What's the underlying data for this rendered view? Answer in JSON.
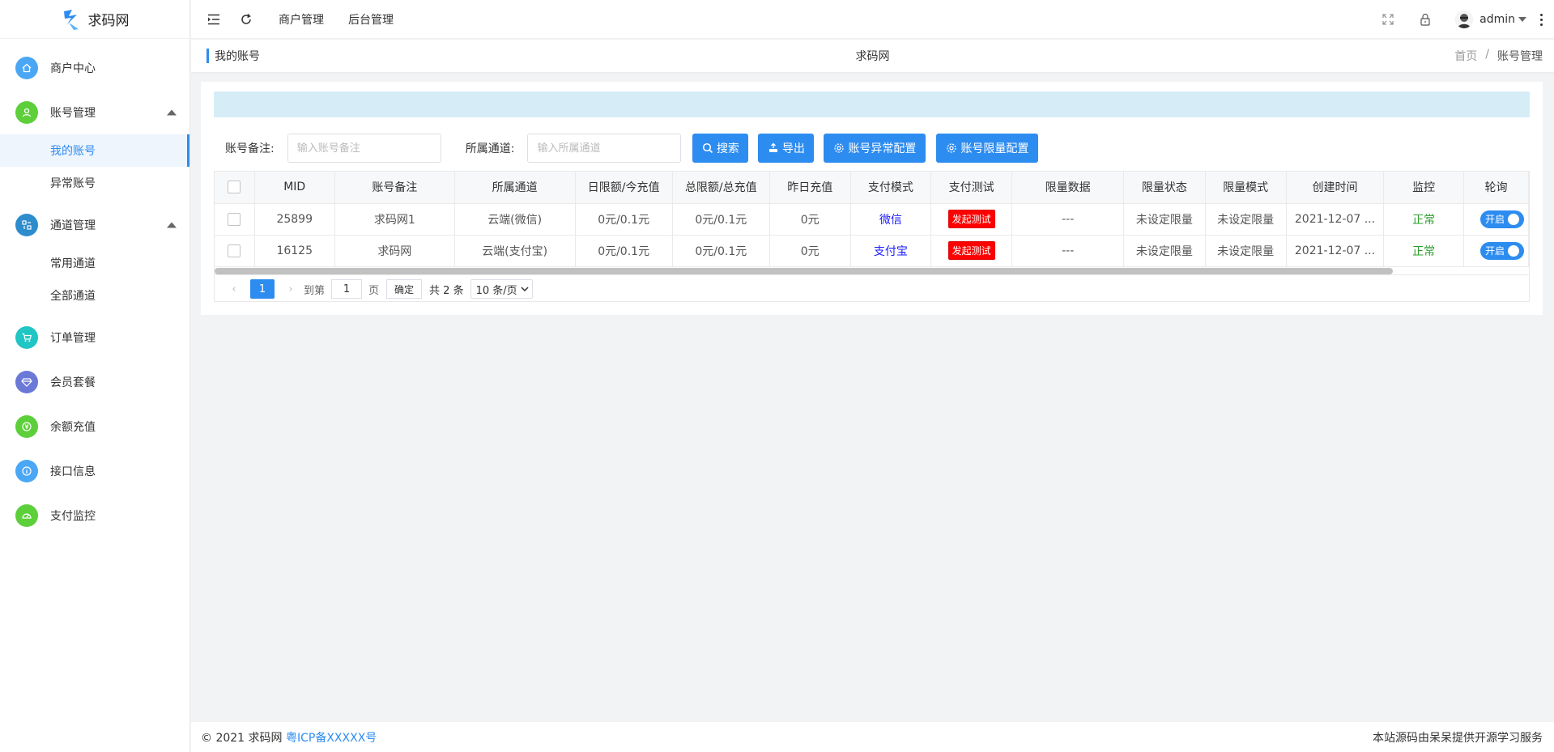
{
  "app": {
    "logo_text": "求码网"
  },
  "sidebar": {
    "items": [
      {
        "label": "商户中心",
        "color": "#4aa7f5"
      },
      {
        "label": "账号管理",
        "color": "#5ccf3a",
        "expanded": true,
        "children": [
          {
            "label": "我的账号",
            "active": true
          },
          {
            "label": "异常账号"
          }
        ]
      },
      {
        "label": "通道管理",
        "color": "#2d8ccc",
        "expanded": true,
        "children": [
          {
            "label": "常用通道"
          },
          {
            "label": "全部通道"
          }
        ]
      },
      {
        "label": "订单管理",
        "color": "#20c6c3"
      },
      {
        "label": "会员套餐",
        "color": "#6a78d6"
      },
      {
        "label": "余额充值",
        "color": "#5ccf3a"
      },
      {
        "label": "接口信息",
        "color": "#4aa7f5"
      },
      {
        "label": "支付监控",
        "color": "#5ccf3a"
      }
    ]
  },
  "topbar": {
    "links": [
      "商户管理",
      "后台管理"
    ],
    "username": "admin"
  },
  "titlebar": {
    "left": "我的账号",
    "center": "求码网",
    "breadcrumb": [
      "首页",
      "账号管理"
    ],
    "separator": "/"
  },
  "filter": {
    "remark_label": "账号备注:",
    "remark_placeholder": "输入账号备注",
    "channel_label": "所属通道:",
    "channel_placeholder": "输入所属通道",
    "buttons": [
      "搜索",
      "导出",
      "账号异常配置",
      "账号限量配置"
    ]
  },
  "table": {
    "columns": [
      "MID",
      "账号备注",
      "所属通道",
      "日限额/今充值",
      "总限额/总充值",
      "昨日充值",
      "支付模式",
      "支付测试",
      "限量数据",
      "限量状态",
      "限量模式",
      "创建时间",
      "监控",
      "轮询"
    ],
    "rows": [
      {
        "mid": "25899",
        "remark": "求码网1",
        "channel": "云端(微信)",
        "daily": "0元/0.1元",
        "total": "0元/0.1元",
        "yesterday": "0元",
        "mode": "微信",
        "test": "发起测试",
        "limit_data": "---",
        "limit_status": "未设定限量",
        "limit_mode": "未设定限量",
        "created": "2021-12-07 ...",
        "monitor": "正常",
        "poll": "开启"
      },
      {
        "mid": "16125",
        "remark": "求码网",
        "channel": "云端(支付宝)",
        "daily": "0元/0.1元",
        "total": "0元/0.1元",
        "yesterday": "0元",
        "mode": "支付宝",
        "test": "发起测试",
        "limit_data": "---",
        "limit_status": "未设定限量",
        "limit_mode": "未设定限量",
        "created": "2021-12-07 ...",
        "monitor": "正常",
        "poll": "开启"
      }
    ]
  },
  "pager": {
    "current": "1",
    "goto_label": "到第",
    "goto_value": "1",
    "page_unit": "页",
    "confirm": "确定",
    "total": "共 2 条",
    "page_size": "10 条/页"
  },
  "footer": {
    "copyright": "© 2021 求码网",
    "icp": "粤ICP备XXXXX号",
    "right": "本站源码由呆呆提供开源学习服务"
  }
}
